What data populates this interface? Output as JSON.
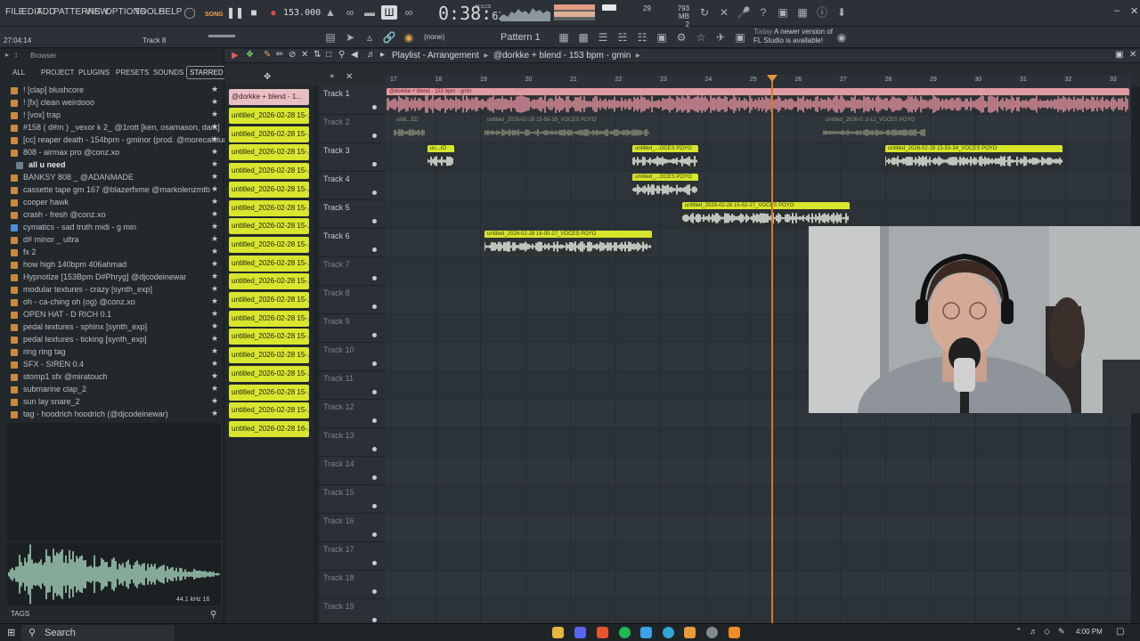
{
  "menu": [
    "FILE",
    "EDIT",
    "ADD",
    "PATTERNS",
    "VIEW",
    "OPTIONS",
    "TOOLS",
    "HELP"
  ],
  "transport": {
    "song_label": "SONG",
    "tempo": "153.000",
    "time_main": "0:38:",
    "time_sub": "62",
    "time_unit": "M:S:CS"
  },
  "status": {
    "polyphony": "29",
    "memory": "793 MB",
    "cpu_cores": "2"
  },
  "hint": {
    "time": "27:04:14",
    "track": "Track 8"
  },
  "toolbar": {
    "none_label": "(none)",
    "pattern": "Pattern 1",
    "news_date": "Today",
    "news_line1": "A newer version of",
    "news_line2": "FL Studio is available!"
  },
  "browser": {
    "title": "Browser",
    "tabs": [
      "ALL",
      "PROJECT",
      "PLUGINS",
      "PRESETS",
      "SOUNDS",
      "STARRED"
    ],
    "items": [
      {
        "label": "! [clap] blushcore",
        "kind": "folder"
      },
      {
        "label": "! [fx] clean weirdooo",
        "kind": "folder"
      },
      {
        "label": "! [vox] trap",
        "kind": "folder"
      },
      {
        "label": "#158 ( d#m ) _vexor k 2_ @1rott [ken, osamason, dark]",
        "kind": "folder"
      },
      {
        "label": "[cc] reaper death - 154bpm - gminor (prod. @morecalcium)",
        "kind": "folder"
      },
      {
        "label": "808 - airmax pro @conz.xo",
        "kind": "folder"
      },
      {
        "label": "all u need",
        "kind": "file",
        "bold": true
      },
      {
        "label": "BANKSY 808 _ @ADANMADE",
        "kind": "folder"
      },
      {
        "label": "cassette tape gm 167 @blazerfxme @markolenzmtb",
        "kind": "folder"
      },
      {
        "label": "cooper hawk",
        "kind": "folder"
      },
      {
        "label": "crash - fresh @conz.xo",
        "kind": "folder"
      },
      {
        "label": "cymatics - sad truth midi - g min",
        "kind": "blue"
      },
      {
        "label": "d# minor _ ultra",
        "kind": "folder"
      },
      {
        "label": "fx 2",
        "kind": "folder"
      },
      {
        "label": "how high 140bpm 406ahmad",
        "kind": "folder"
      },
      {
        "label": "Hypnotize [153Bpm D#Phryg] @djcodeinewar",
        "kind": "folder"
      },
      {
        "label": "modular textures - crazy [synth_exp]",
        "kind": "folder"
      },
      {
        "label": "oh - ca-ching oh (og) @conz.xo",
        "kind": "folder"
      },
      {
        "label": "OPEN HAT - D RICH 0.1",
        "kind": "folder"
      },
      {
        "label": "pedal textures - sphinx [synth_exp]",
        "kind": "folder"
      },
      {
        "label": "pedal textures - ticking [synth_exp]",
        "kind": "folder"
      },
      {
        "label": "ring ring tag",
        "kind": "folder"
      },
      {
        "label": "SFX - SIREN 0.4",
        "kind": "folder"
      },
      {
        "label": "stomp1 sfx @miratouch",
        "kind": "folder"
      },
      {
        "label": "submarine clap_2",
        "kind": "folder"
      },
      {
        "label": "sun lay snare_2",
        "kind": "folder"
      },
      {
        "label": "tag - hoodrich hoodrich (@djcodeinewar)",
        "kind": "folder"
      }
    ],
    "sample_info": "44.1 kHz 16",
    "tags_label": "TAGS"
  },
  "picker": {
    "first": "@dorkke + blend - 1...",
    "items": [
      "untitled_2026-02-28 15-...",
      "untitled_2026-02-28 15-...",
      "untitled_2026-02-28 15-...",
      "untitled_2026-02-28 15-...",
      "untitled_2026-02-28 15-...",
      "untitled_2026-02-28 15-...",
      "untitled_2026-02-28 15-...",
      "untitled_2026-02-28 15-...",
      "untitled_2026-02-28 15-...",
      "untitled_2026-02-28 15-...",
      "untitled_2026-02-28 15-...",
      "untitled_2026-02-28 15-...",
      "untitled_2026-02-28 15-...",
      "untitled_2026-02-28 15-...",
      "untitled_2026-02-28 15-...",
      "untitled_2026-02-28 15-...",
      "untitled_2026-02-28 15-...",
      "untitled_2026-02-28 16-..."
    ]
  },
  "playlist": {
    "title": "Playlist - Arrangement",
    "song": "@dorkke + blend - 153 bpm - gmin",
    "ruler": [
      "17",
      "18",
      "19",
      "20",
      "21",
      "22",
      "23",
      "24",
      "25",
      "26",
      "27",
      "28",
      "29",
      "30",
      "31",
      "32",
      "33"
    ],
    "tracks": [
      "Track 1",
      "Track 2",
      "Track 3",
      "Track 4",
      "Track 5",
      "Track 6",
      "Track 7",
      "Track 8",
      "Track 9",
      "Track 10",
      "Track 11",
      "Track 12",
      "Track 13",
      "Track 14",
      "Track 15",
      "Track 16",
      "Track 17",
      "Track 18",
      "Track 19"
    ],
    "clips": [
      {
        "label": "@dorkke + blend - 153 bpm - gmin",
        "style": "red"
      },
      {
        "label": "untit...ED",
        "style": "g"
      },
      {
        "label": "untitled_2026-02-28 15-58-39_VOCES POYO",
        "style": "g"
      },
      {
        "label": "untitled_2026-0..3-12_VOCES POYO",
        "style": "g"
      },
      {
        "label": "un...IO",
        "style": "y"
      },
      {
        "label": "untitled_...OCES POYO",
        "style": "y"
      },
      {
        "label": "untitled_2026-02-28 15-53-34_VOCES POYO",
        "style": "y"
      },
      {
        "label": "untitled_...OCES POYO",
        "style": "y"
      },
      {
        "label": "untitled_2026-02-28 15-52-27_VOCES POYO",
        "style": "y"
      },
      {
        "label": "untitled_2026-02-28 16-00-27_VOCES POYO",
        "style": "y"
      }
    ]
  },
  "taskbar": {
    "search": "Search",
    "time": "4:00 PM"
  }
}
